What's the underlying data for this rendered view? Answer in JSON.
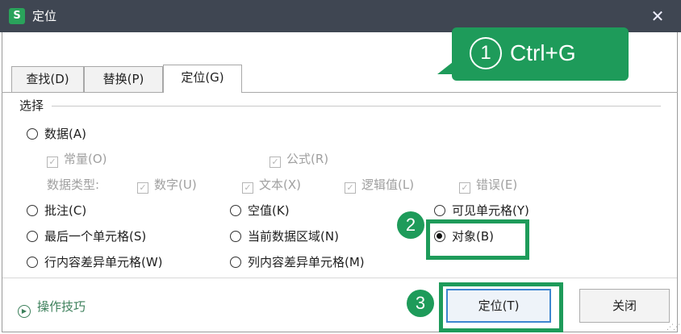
{
  "window": {
    "app_icon": "S",
    "title": "定位",
    "close_glyph": "✕"
  },
  "tabs": [
    {
      "label": "查找(D)"
    },
    {
      "label": "替换(P)"
    },
    {
      "label": "定位(G)"
    }
  ],
  "section": {
    "label": "选择"
  },
  "options": {
    "data": "数据(A)",
    "constants": "常量(O)",
    "formulas": "公式(R)",
    "data_type_label": "数据类型:",
    "number": "数字(U)",
    "text": "文本(X)",
    "logical": "逻辑值(L)",
    "error": "错误(E)",
    "comments": "批注(C)",
    "blanks": "空值(K)",
    "visible_cells": "可见单元格(Y)",
    "last_cell": "最后一个单元格(S)",
    "current_region": "当前数据区域(N)",
    "objects": "对象(B)",
    "row_diff": "行内容差异单元格(W)",
    "col_diff": "列内容差异单元格(M)"
  },
  "footer": {
    "tips": "操作技巧",
    "locate_button": "定位(T)",
    "close_button": "关闭"
  },
  "annotations": {
    "step1_number": "1",
    "step1_text": "Ctrl+G",
    "step2_number": "2",
    "step3_number": "3"
  },
  "colors": {
    "titlebar": "#3f4652",
    "annotation_green": "#1e9b5a",
    "primary_border": "#3d86cf"
  }
}
